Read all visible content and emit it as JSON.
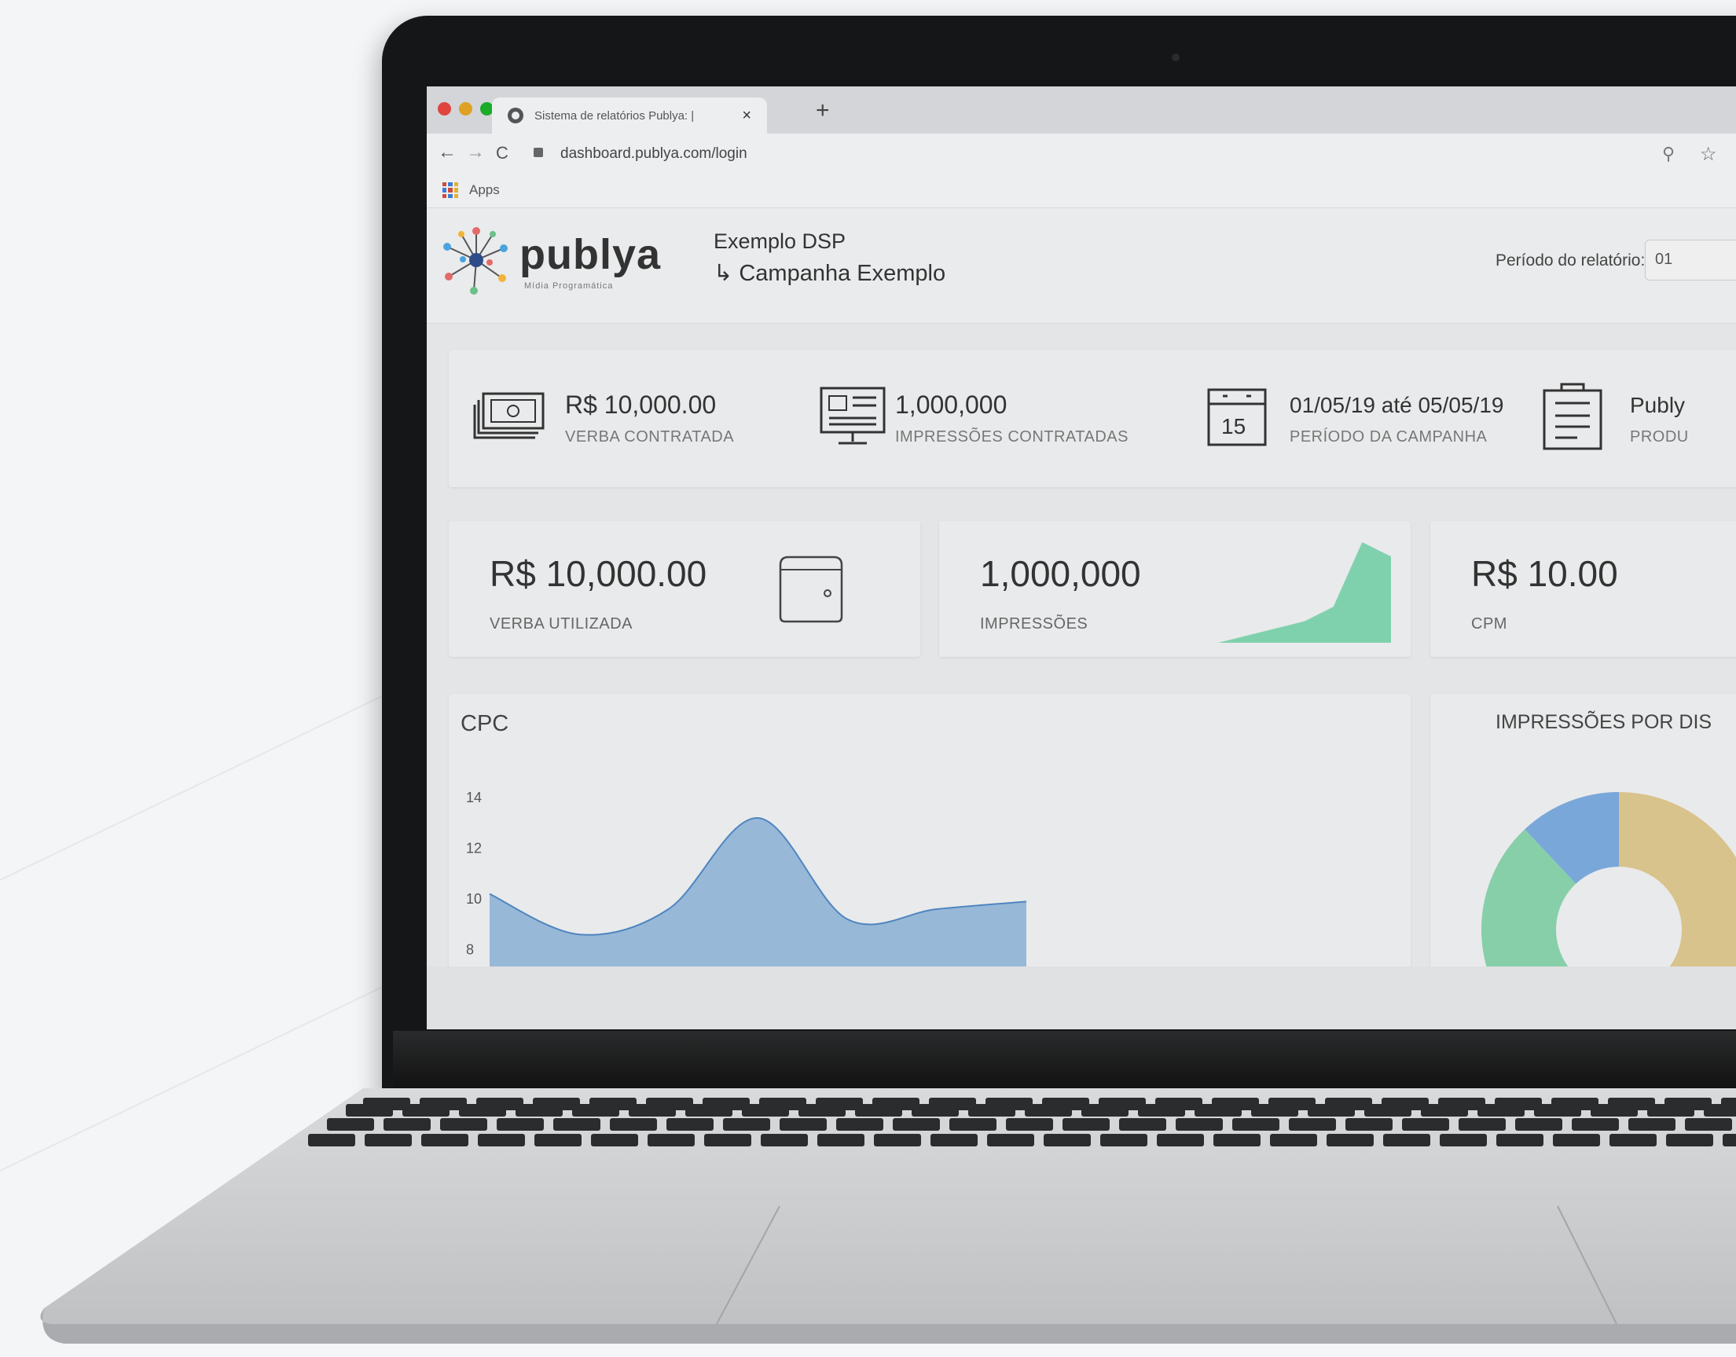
{
  "browser": {
    "tab_title": "Sistema de relatórios Publya: |",
    "tab_close": "×",
    "new_tab": "+",
    "url": "dashboard.publya.com/login",
    "bookmarks_apps": "Apps",
    "back": "←",
    "forward": "→",
    "reload": "C",
    "search_glyph": "⚲",
    "star_glyph": "☆"
  },
  "app": {
    "logo_text": "publya",
    "logo_sub": "Mídia Programática",
    "breadcrumb_top": "Exemplo DSP",
    "breadcrumb_sub": "↳ Campanha Exemplo",
    "period_label": "Período do relatório:",
    "period_value": "01"
  },
  "summary": {
    "budget_value": "R$ 10,000.00",
    "budget_label": "VERBA CONTRATADA",
    "impressions_value": "1,000,000",
    "impressions_label": "IMPRESSÕES CONTRATADAS",
    "calendar_day": "15",
    "period_value": "01/05/19 até 05/05/19",
    "period_label": "PERÍODO DA CAMPANHA",
    "product_value": "Publy",
    "product_label": "PRODU"
  },
  "kpis": {
    "used_budget_value": "R$ 10,000.00",
    "used_budget_label": "VERBA UTILIZADA",
    "impressions_value": "1,000,000",
    "impressions_label": "IMPRESSÕES",
    "cpm_value": "R$ 10.00",
    "cpm_label": "CPM"
  },
  "charts": {
    "cpc_title": "CPC",
    "donut_title": "IMPRESSÕES POR DIS"
  },
  "colors": {
    "cpc_fill": "#8fb3d6",
    "cpc_stroke": "#4f86c0",
    "spark_fill": "#7fd1ae",
    "donut_blue": "#7aa7d9",
    "donut_tan": "#d9c38c",
    "donut_green": "#86cfa9"
  },
  "chart_data": [
    {
      "type": "area",
      "title": "CPC",
      "yticks": [
        14,
        12,
        10,
        8
      ],
      "ylim": [
        6,
        15
      ],
      "x": [
        0,
        1,
        2,
        3,
        4,
        5,
        6
      ],
      "values": [
        10.2,
        8.6,
        9.6,
        13.2,
        9.2,
        9.6,
        9.9
      ]
    },
    {
      "type": "area",
      "title": "IMPRESSÕES",
      "values": [
        0,
        1,
        2,
        3,
        5,
        14,
        12
      ]
    },
    {
      "type": "pie",
      "title": "IMPRESSÕES POR DIS",
      "series": [
        {
          "color": "#d9c38c",
          "value": 0.5
        },
        {
          "color": "#86cfa9",
          "value": 0.38
        },
        {
          "color": "#7aa7d9",
          "value": 0.12
        }
      ]
    }
  ]
}
